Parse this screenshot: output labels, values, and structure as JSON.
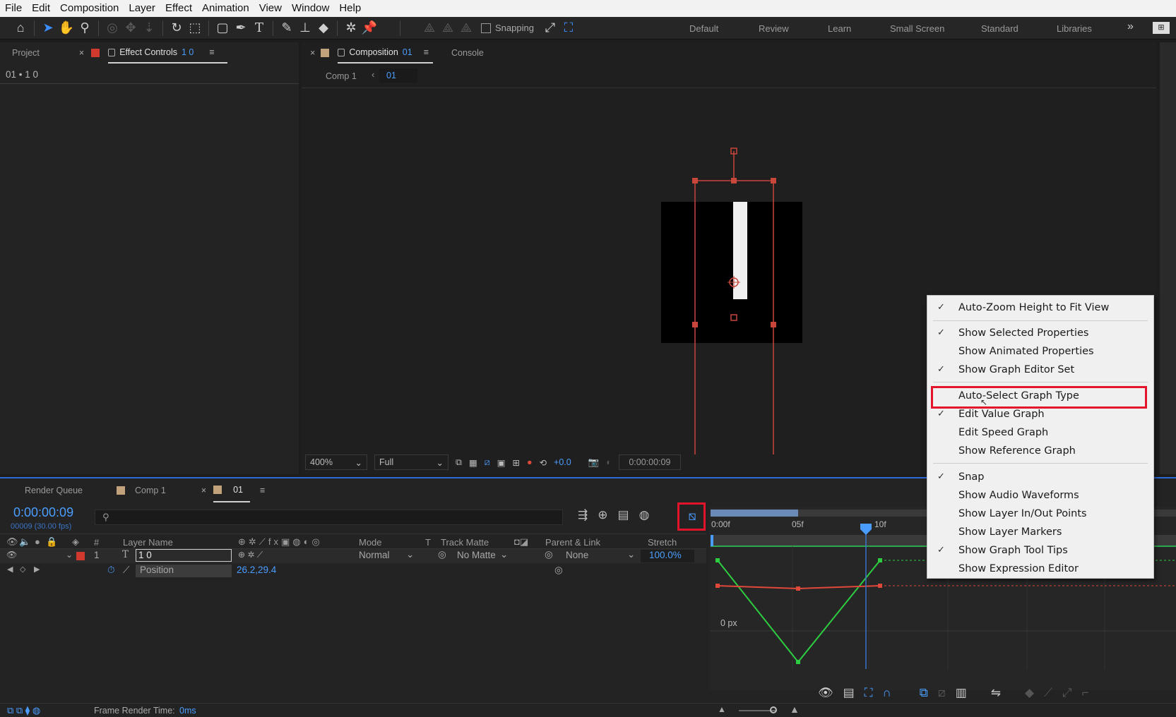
{
  "menubar": {
    "items": [
      "File",
      "Edit",
      "Composition",
      "Layer",
      "Effect",
      "Animation",
      "View",
      "Window",
      "Help"
    ]
  },
  "toolbar": {
    "snapping_label": "Snapping",
    "workspaces": [
      "Default",
      "Review",
      "Learn",
      "Small Screen",
      "Standard",
      "Libraries"
    ]
  },
  "left_panel": {
    "tab_project": "Project",
    "tab_effect_controls": "Effect Controls",
    "effect_controls_layer": "1 0",
    "breadcrumb": "01 • 1 0"
  },
  "composition_panel": {
    "tab_composition": "Composition",
    "comp_name": "01",
    "tab_console": "Console",
    "breadcrumb_parent": "Comp 1",
    "breadcrumb_current": "01",
    "zoom": "400%",
    "resolution": "Full",
    "exposure": "+0.0",
    "timecode": "0:00:00:09"
  },
  "context_menu": {
    "items": [
      {
        "label": "Auto-Zoom Height to Fit View",
        "checked": true
      },
      {
        "label": "Show Selected Properties",
        "checked": true
      },
      {
        "label": "Show Animated Properties",
        "checked": false
      },
      {
        "label": "Show Graph Editor Set",
        "checked": true
      },
      {
        "label": "Auto-Select Graph Type",
        "checked": false
      },
      {
        "label": "Edit Value Graph",
        "checked": true
      },
      {
        "label": "Edit Speed Graph",
        "checked": false
      },
      {
        "label": "Show Reference Graph",
        "checked": false
      },
      {
        "label": "Snap",
        "checked": true
      },
      {
        "label": "Show Audio Waveforms",
        "checked": false
      },
      {
        "label": "Show Layer In/Out Points",
        "checked": false
      },
      {
        "label": "Show Layer Markers",
        "checked": false
      },
      {
        "label": "Show Graph Tool Tips",
        "checked": true
      },
      {
        "label": "Show Expression Editor",
        "checked": false
      }
    ]
  },
  "timeline": {
    "tab_render_queue": "Render Queue",
    "tab_comp1": "Comp 1",
    "tab_01": "01",
    "current_time": "0:00:00:09",
    "frame_info": "00009 (30.00 fps)",
    "columns": {
      "hash": "#",
      "layer_name": "Layer Name",
      "mode": "Mode",
      "t": "T",
      "track_matte": "Track Matte",
      "parent_link": "Parent & Link",
      "stretch": "Stretch"
    },
    "layer": {
      "index": "1",
      "name": "1 0",
      "mode": "Normal",
      "track_matte": "No Matte",
      "parent": "None",
      "stretch": "100.0%"
    },
    "property": {
      "name": "Position",
      "value": "26.2,29.4"
    },
    "ruler": [
      "0:00f",
      "05f",
      "10f"
    ],
    "graph_label": "0 px",
    "status": {
      "label": "Frame Render Time:",
      "value": "0ms"
    }
  }
}
